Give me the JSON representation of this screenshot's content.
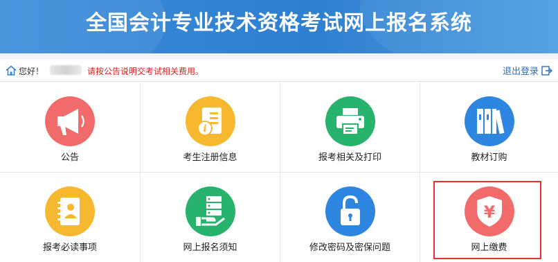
{
  "header": {
    "title": "全国会计专业技术资格考试网上报名系统",
    "bg_color": "#3587d6"
  },
  "infobar": {
    "greeting": "您好！",
    "notice": "请按公告说明交考试相关费用。",
    "notice_color": "#e02020",
    "logout": "退出登录"
  },
  "tiles": [
    {
      "label": "公告",
      "icon": "megaphone-icon",
      "color": "#f26b6b"
    },
    {
      "label": "考生注册信息",
      "icon": "info-document-icon",
      "color": "#f5b82e"
    },
    {
      "label": "报考相关及打印",
      "icon": "printer-icon",
      "color": "#27b36b"
    },
    {
      "label": "教材订购",
      "icon": "books-icon",
      "color": "#2f86e0"
    },
    {
      "label": "报考必读事项",
      "icon": "address-book-icon",
      "color": "#f5b82e"
    },
    {
      "label": "网上报名须知",
      "icon": "hand-server-icon",
      "color": "#27b36b"
    },
    {
      "label": "修改密码及密保问题",
      "icon": "lock-icon",
      "color": "#2f86e0"
    },
    {
      "label": "网上缴费",
      "icon": "yuan-shield-icon",
      "color": "#f26b6b"
    }
  ]
}
